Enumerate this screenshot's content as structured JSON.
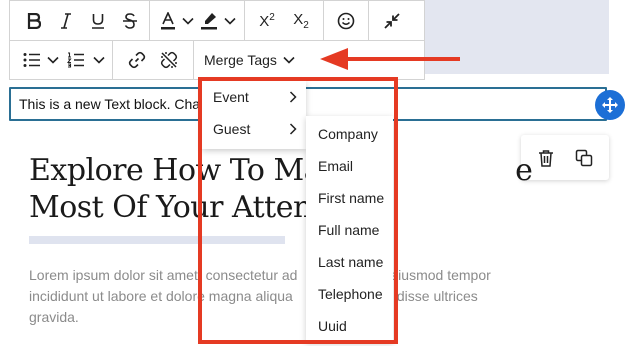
{
  "toolbar": {
    "row1": [
      "bold-icon",
      "italic-icon",
      "underline-icon",
      "strikethrough-icon",
      "text-color-icon",
      "chevron-down-icon",
      "highlight-icon",
      "chevron-down-icon",
      "superscript-icon",
      "subscript-icon",
      "emoji-icon",
      "collapse-icon"
    ],
    "row2": [
      "bullet-list-icon",
      "chevron-down-icon",
      "numbered-list-icon",
      "chevron-down-icon",
      "link-icon",
      "unlink-icon"
    ],
    "merge_tags_label": "Merge Tags"
  },
  "editor": {
    "text_block": "This is a new Text block. Cha",
    "heading_line1": "Explore How To Ma",
    "heading_line1_end": "e",
    "heading_line2": "Most Of Your Atten",
    "lorem_line1_a": "Lorem ipsum dolor sit amet, consectetur ad",
    "lorem_line1_b": "ed do eiusmod tempor",
    "lorem_line2_a": "incididunt ut labore et dolore magna aliqua",
    "lorem_line2_b": "uspen disse ultrices",
    "lorem_line3": "gravida."
  },
  "merge_menu": {
    "items": [
      "Event",
      "Guest"
    ]
  },
  "guest_submenu": {
    "items": [
      "Company",
      "Email",
      "First name",
      "Full name",
      "Last name",
      "Telephone",
      "Uuid"
    ]
  },
  "colors": {
    "accent_blue": "#1c6fd6",
    "border_teal": "#2a6f94",
    "callout_red": "#e53a23"
  }
}
